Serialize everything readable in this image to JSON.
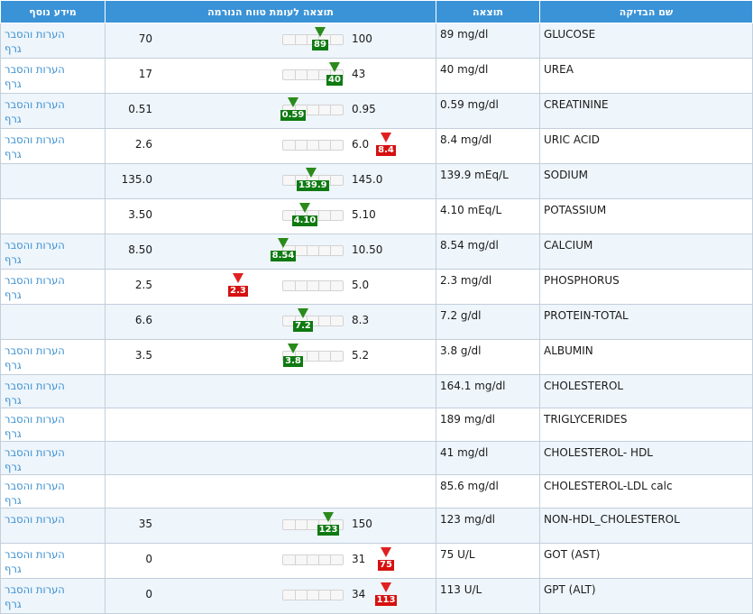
{
  "columns": {
    "more_info": "מידע נוסף",
    "result_vs_range": "תוצאה לעומת טווח הנורמה",
    "result": "תוצאה",
    "test_name": "שם הבדיקה"
  },
  "links": {
    "notes": "הערות והסבר",
    "graph": "גרף"
  },
  "rows": [
    {
      "name": "GLUCOSE",
      "result": "89 mg/dl",
      "low": "70",
      "high": "100",
      "value": "89",
      "status": "normal",
      "marker_fraction": 0.63,
      "notes": true,
      "graph": true
    },
    {
      "name": "UREA",
      "result": "40 mg/dl",
      "low": "17",
      "high": "43",
      "value": "40",
      "status": "normal",
      "marker_fraction": 0.88,
      "notes": true,
      "graph": true
    },
    {
      "name": "CREATININE",
      "result": "0.59 mg/dl",
      "low": "0.51",
      "high": "0.95",
      "value": "0.59",
      "status": "normal",
      "marker_fraction": 0.18,
      "notes": true,
      "graph": true
    },
    {
      "name": "URIC ACID",
      "result": "8.4 mg/dl",
      "low": "2.6",
      "high": "6.0",
      "value": "8.4",
      "status": "high",
      "notes": true,
      "graph": true
    },
    {
      "name": "SODIUM",
      "result": "139.9 mEq/L",
      "low": "135.0",
      "high": "145.0",
      "value": "139.9",
      "status": "normal",
      "marker_fraction": 0.49,
      "notes": false,
      "graph": false
    },
    {
      "name": "POTASSIUM",
      "result": "4.10 mEq/L",
      "low": "3.50",
      "high": "5.10",
      "value": "4.10",
      "status": "normal",
      "marker_fraction": 0.38,
      "notes": false,
      "graph": false
    },
    {
      "name": "CALCIUM",
      "result": "8.54 mg/dl",
      "low": "8.50",
      "high": "10.50",
      "value": "8.54",
      "status": "normal",
      "marker_fraction": 0.02,
      "notes": true,
      "graph": true
    },
    {
      "name": "PHOSPHORUS",
      "result": "2.3 mg/dl",
      "low": "2.5",
      "high": "5.0",
      "value": "2.3",
      "status": "low",
      "notes": true,
      "graph": true
    },
    {
      "name": "PROTEIN-TOTAL",
      "result": "7.2 g/dl",
      "low": "6.6",
      "high": "8.3",
      "value": "7.2",
      "status": "normal",
      "marker_fraction": 0.35,
      "notes": false,
      "graph": false
    },
    {
      "name": "ALBUMIN",
      "result": "3.8 g/dl",
      "low": "3.5",
      "high": "5.2",
      "value": "3.8",
      "status": "normal",
      "marker_fraction": 0.18,
      "notes": true,
      "graph": true
    },
    {
      "name": "CHOLESTEROL",
      "result": "164.1 mg/dl",
      "notes": true,
      "graph": true
    },
    {
      "name": "TRIGLYCERIDES",
      "result": "189 mg/dl",
      "notes": true,
      "graph": true
    },
    {
      "name": "CHOLESTEROL- HDL",
      "result": "41 mg/dl",
      "notes": true,
      "graph": true
    },
    {
      "name": "CHOLESTEROL-LDL calc",
      "result": "85.6 mg/dl",
      "notes": true,
      "graph": true
    },
    {
      "name": "NON-HDL_CHOLESTEROL",
      "result": "123 mg/dl",
      "low": "35",
      "high": "150",
      "value": "123",
      "status": "normal",
      "marker_fraction": 0.77,
      "notes": true,
      "graph": false
    },
    {
      "name": "GOT (AST)",
      "result": "75 U/L",
      "low": "0",
      "high": "31",
      "value": "75",
      "status": "high",
      "notes": true,
      "graph": true
    },
    {
      "name": "GPT (ALT)",
      "result": "113 U/L",
      "low": "0",
      "high": "34",
      "value": "113",
      "status": "high",
      "notes": true,
      "graph": true
    }
  ],
  "colors": {
    "header_bg": "#3a93d7",
    "row_alt_bg": "#eef5fb",
    "link": "#3a8fd0",
    "in_range": "#0f7a12",
    "out_of_range": "#d61010"
  }
}
